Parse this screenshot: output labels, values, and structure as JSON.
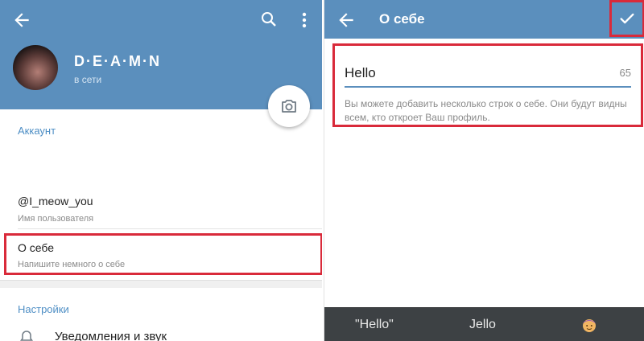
{
  "left_panel": {
    "profile": {
      "name": "D·E·A·M·N",
      "status": "в сети"
    },
    "account_section": {
      "title": "Аккаунт",
      "username": {
        "value": "@I_meow_you",
        "label": "Имя пользователя"
      },
      "bio": {
        "value": "О себе",
        "label": "Напишите немного о себе"
      }
    },
    "settings_section": {
      "title": "Настройки",
      "notifications_label": "Уведомления и звук"
    }
  },
  "right_panel": {
    "title": "О себе",
    "bio_input": {
      "value": "Hello",
      "remaining_chars": "65"
    },
    "hint": "Вы можете добавить несколько строк о себе. Они будут видны всем, кто откроет Ваш профиль.",
    "keyboard_suggestions": [
      "\"Hello\"",
      "Jello"
    ]
  },
  "colors": {
    "header": "#5b8fbd",
    "accent": "#4f8fc5",
    "highlight": "#d92a3a",
    "keyboard_bar": "#3d4144"
  }
}
